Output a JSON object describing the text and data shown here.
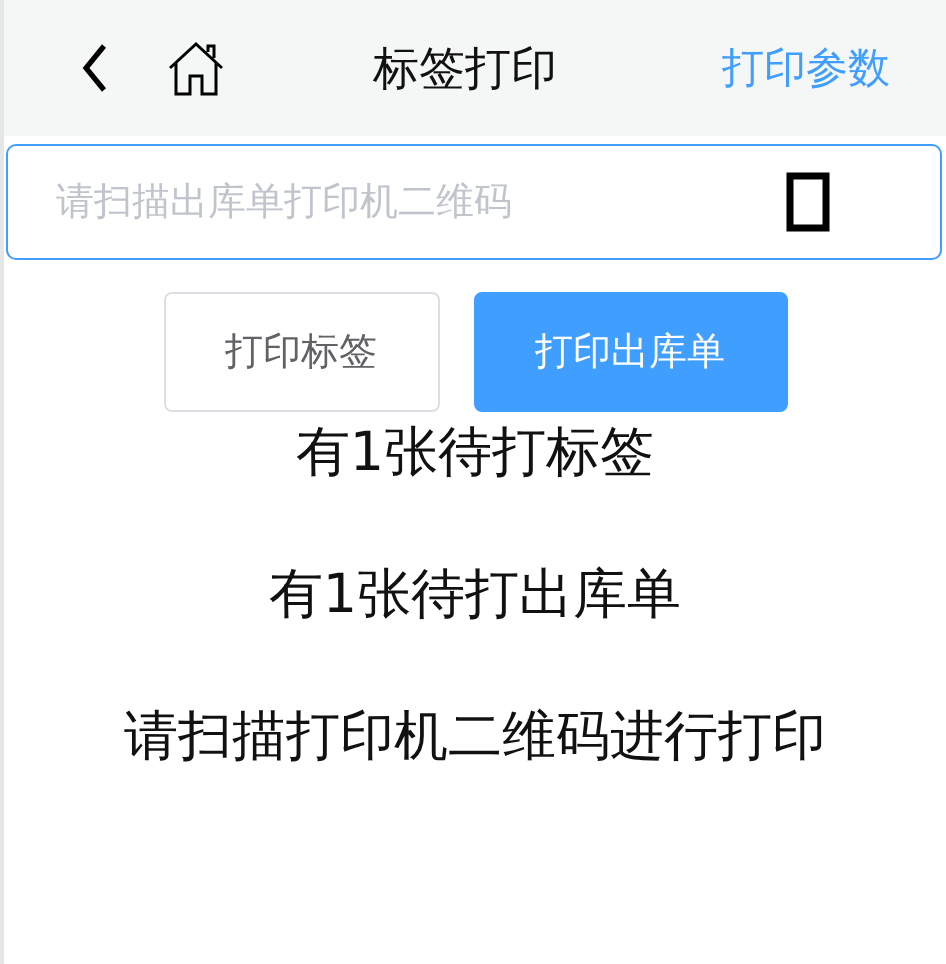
{
  "header": {
    "title": "标签打印",
    "action": "打印参数"
  },
  "scan_field": {
    "placeholder": "请扫描出库单打印机二维码"
  },
  "buttons": [
    {
      "label": "打印标签",
      "kind": "plain"
    },
    {
      "label": "打印出库单",
      "kind": "primary"
    }
  ],
  "messages": [
    "有1张待打标签",
    "有1张待打出库单",
    "请扫描打印机二维码进行打印"
  ]
}
